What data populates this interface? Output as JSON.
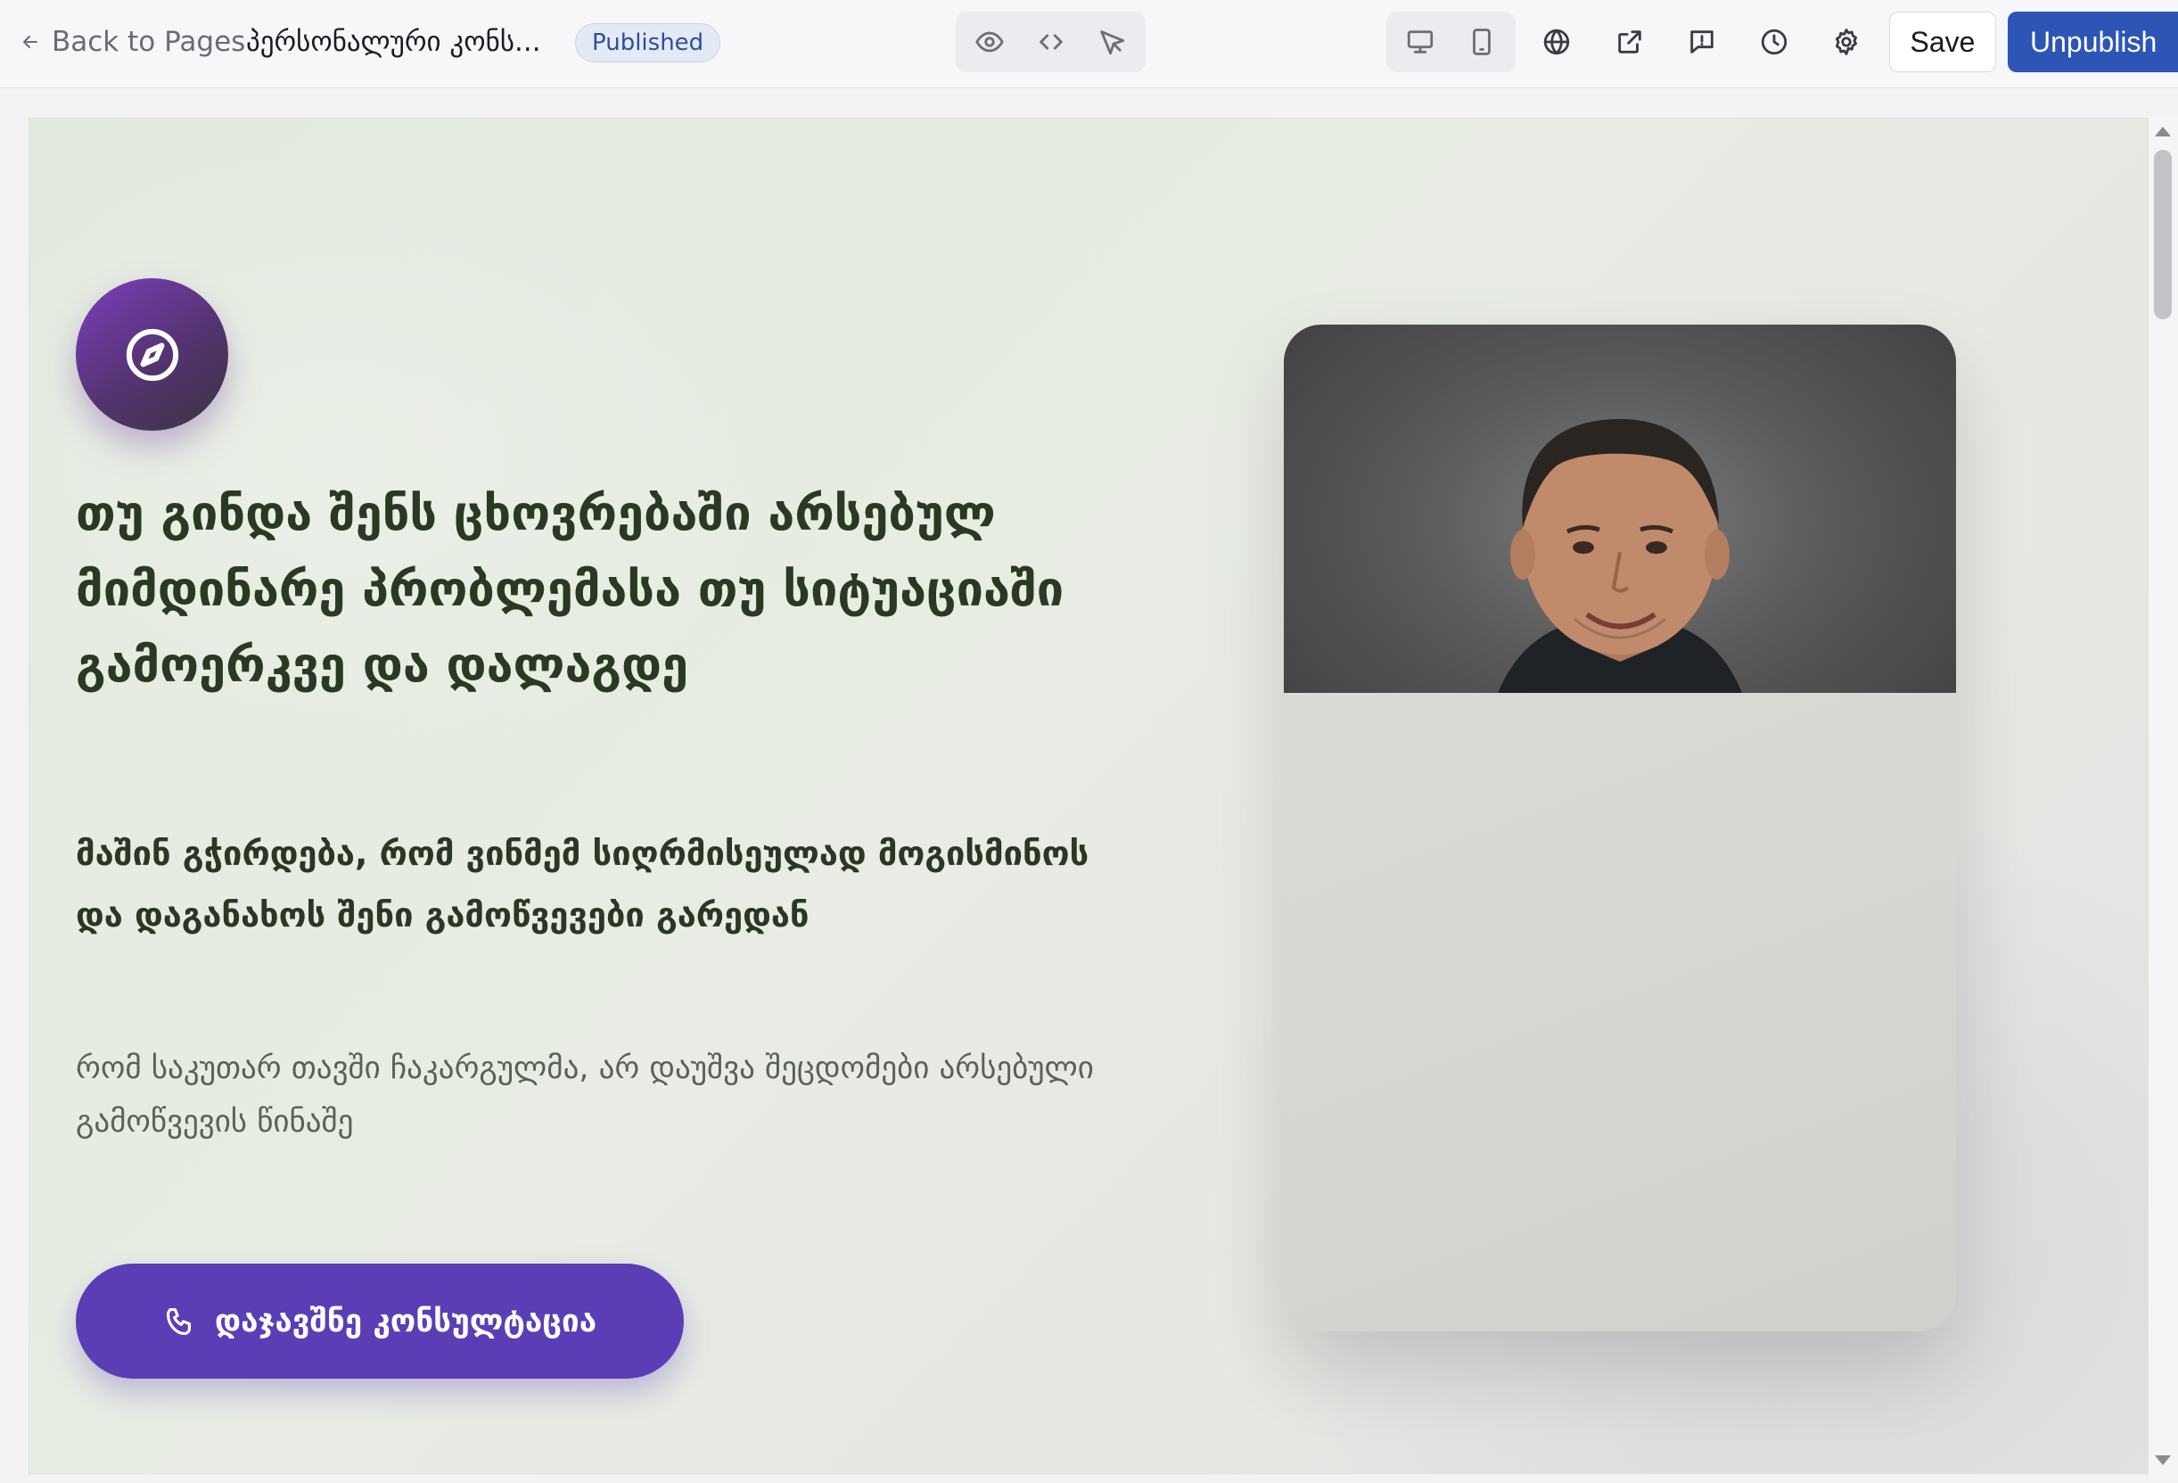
{
  "toolbar": {
    "back_label": "Back to Pages",
    "page_title": "პერსონალური კონს...",
    "status_badge": "Published",
    "save_label": "Save",
    "unpublish_label": "Unpublish",
    "icons": [
      "arrow-left-icon",
      "eye-icon",
      "code-icon",
      "cursor-icon",
      "desktop-icon",
      "mobile-icon",
      "globe-icon",
      "external-link-icon",
      "comment-icon",
      "clock-icon",
      "gear-icon"
    ]
  },
  "hero": {
    "icon": "compass-icon",
    "headline": "თუ გინდა შენს ცხოვრებაში არსებულ მიმდინარე პრობლემასა თუ სიტუაციაში გამოერკვე და დალაგდე",
    "subheadline": "მაშინ გჭირდება, რომ ვინმემ სიღრმისეულად მოგისმინოს და დაგანახოს შენი გამოწვევები გარედან",
    "body": "რომ საკუთარ თავში ჩაკარგულმა, არ დაუშვა შეცდომები არსებული გამოწვევის წინაშე",
    "cta_label": "დაჯავშნე კონსულტაცია",
    "cta_icon": "phone-icon"
  },
  "colors": {
    "primary_button": "#2d55b6",
    "cta": "#5b3eb6",
    "heading_text": "#2a3a22",
    "badge_text": "#2e4f9c"
  }
}
